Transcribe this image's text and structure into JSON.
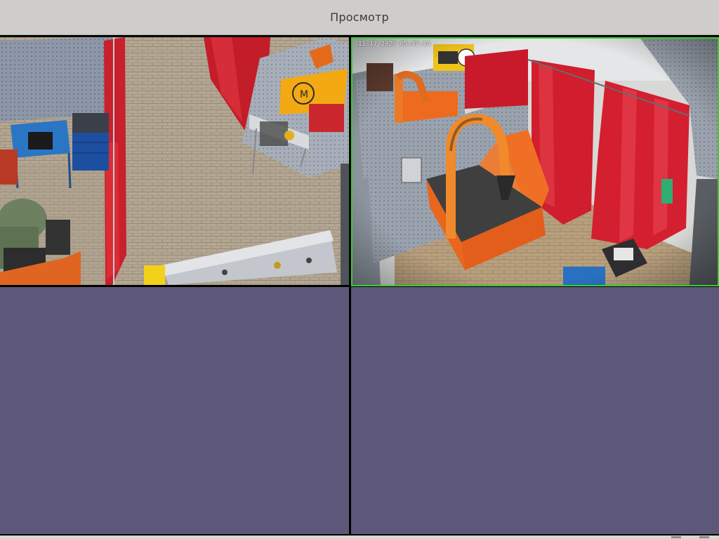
{
  "window": {
    "title": "Просмотр"
  },
  "cameras": [
    {
      "id": "cam-1",
      "selected": false,
      "timestamp": "",
      "name": "",
      "scene": "welding-workshop-overview"
    },
    {
      "id": "cam-2",
      "selected": true,
      "timestamp": "11-17-2020 05:47:14",
      "name": "",
      "scene": "welding-booth-fume-extractor"
    },
    {
      "id": "cam-3",
      "selected": false,
      "empty": true
    },
    {
      "id": "cam-4",
      "selected": false,
      "empty": true
    }
  ],
  "colors": {
    "selected_border": "#33d12e",
    "empty_cell": "#5d5879",
    "titlebar": "#cfcdcb",
    "separator": "#000000"
  }
}
